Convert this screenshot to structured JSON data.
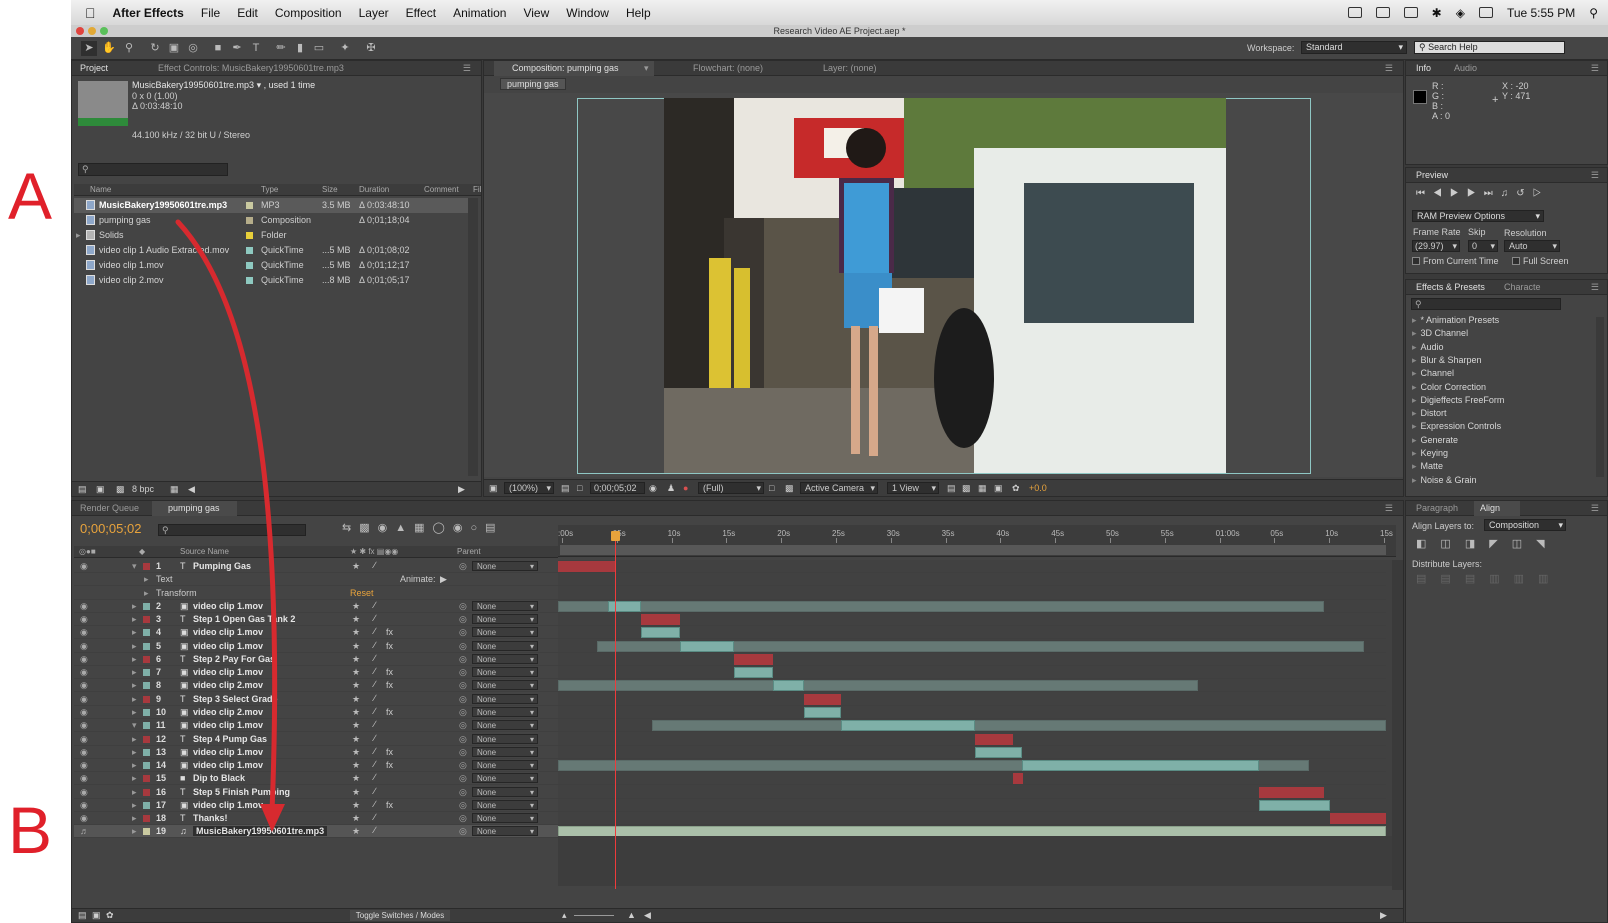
{
  "annotations": {
    "a": "A",
    "b": "B"
  },
  "colors": {
    "accent": "#e8a33c",
    "arrow": "#d72a2f",
    "layer_red": "#a7393e",
    "layer_teal": "#7fb0a8",
    "playhead": "#ee3b3b"
  },
  "menubar": {
    "apple": "apple-icon",
    "app": "After Effects",
    "items": [
      "File",
      "Edit",
      "Composition",
      "Layer",
      "Effect",
      "Animation",
      "View",
      "Window",
      "Help"
    ],
    "clock": "Tue 5:55 PM"
  },
  "window": {
    "title": "Research Video AE Project.aep *"
  },
  "toolbar": {
    "workspace_label": "Workspace:",
    "workspace_value": "Standard",
    "search_placeholder": "Search Help"
  },
  "project": {
    "tabs": [
      "Project",
      "Effect Controls: MusicBakery19950601tre.mp3"
    ],
    "selected_name": "MusicBakery19950601tre.mp3 ▾ , used 1 time",
    "info_lines": [
      "0 x 0 (1.00)",
      "Δ 0:03:48:10"
    ],
    "audio_info": "44.100 kHz / 32 bit U / Stereo",
    "columns": [
      "Name",
      "Type",
      "Size",
      "Duration",
      "Comment",
      "Fil"
    ],
    "items": [
      {
        "name": "MusicBakery19950601tre.mp3",
        "type": "MP3",
        "size": "3.5 MB",
        "duration": "Δ 0:03:48:10",
        "color": "#c9c9a0"
      },
      {
        "name": "pumping gas",
        "type": "Composition",
        "size": "",
        "duration": "Δ 0;01;18;04",
        "color": "#b5ad8a"
      },
      {
        "name": "Solids",
        "type": "Folder",
        "size": "",
        "duration": "",
        "color": "#e8cf3a"
      },
      {
        "name": "video clip 1 Audio Extracted.mov",
        "type": "QuickTime",
        "size": "...5 MB",
        "duration": "Δ 0;01;08;02",
        "color": "#8ec9c0"
      },
      {
        "name": "video clip 1.mov",
        "type": "QuickTime",
        "size": "...5 MB",
        "duration": "Δ 0;01;12;17",
        "color": "#8ec9c0"
      },
      {
        "name": "video clip 2.mov",
        "type": "QuickTime",
        "size": "...8 MB",
        "duration": "Δ 0;01;05;17",
        "color": "#8ec9c0"
      }
    ],
    "bpc": "8 bpc"
  },
  "composition": {
    "tabs": [
      "Composition: pumping gas",
      "Flowchart: (none)",
      "Layer: (none)"
    ],
    "breadcrumb": "pumping gas",
    "zoom": "(100%)",
    "timecode": "0;00;05;02",
    "resolution": "(Full)",
    "camera": "Active Camera",
    "view": "1 View",
    "exposure": "+0.0"
  },
  "info": {
    "tabs": [
      "Info",
      "Audio"
    ],
    "r": "R :",
    "g": "G :",
    "b": "B :",
    "a": "A : 0",
    "x": "X : -20",
    "y": "Y : 471"
  },
  "preview": {
    "tab": "Preview",
    "ram_options": "RAM Preview Options",
    "frame_rate_label": "Frame Rate",
    "skip_label": "Skip",
    "resolution_label": "Resolution",
    "frame_rate": "(29.97)",
    "skip": "0",
    "resolution": "Auto",
    "from_current": "From Current Time",
    "full_screen": "Full Screen"
  },
  "effects": {
    "tabs": [
      "Effects & Presets",
      "Characte"
    ],
    "items": [
      "* Animation Presets",
      "3D Channel",
      "Audio",
      "Blur & Sharpen",
      "Channel",
      "Color Correction",
      "Digieffects FreeForm",
      "Distort",
      "Expression Controls",
      "Generate",
      "Keying",
      "Matte",
      "Noise & Grain"
    ]
  },
  "align": {
    "tabs": [
      "Paragraph",
      "Align"
    ],
    "align_to_label": "Align Layers to:",
    "align_to_value": "Composition",
    "distribute_label": "Distribute Layers:"
  },
  "timeline": {
    "tabs": [
      "Render Queue",
      "pumping gas"
    ],
    "timecode": "0;00;05;02",
    "source_header": "Source Name",
    "parent_header": "Parent",
    "ruler": [
      ":00s",
      "05s",
      "10s",
      "15s",
      "20s",
      "25s",
      "30s",
      "35s",
      "40s",
      "45s",
      "50s",
      "55s",
      "01:00s",
      "05s",
      "10s",
      "15s"
    ],
    "toggle": "Toggle Switches / Modes",
    "animate": "Animate:",
    "reset": "Reset",
    "layers": [
      {
        "num": "1",
        "name": "Pumping Gas",
        "kind": "text",
        "color": "#a7393e",
        "parent": "None",
        "start": 0,
        "end": 0.07,
        "bar": "red",
        "expanded": true,
        "props": [
          "Text",
          "Transform"
        ]
      },
      {
        "num": "2",
        "name": "video clip 1.mov",
        "kind": "footage",
        "color": "#7fb0a8",
        "parent": "None",
        "start": 0,
        "end": 0.925,
        "trim_start": 0.06,
        "trim_end": 0.1,
        "bar": "teal"
      },
      {
        "num": "3",
        "name": "Step 1 Open Gas Tank 2",
        "kind": "text",
        "color": "#a7393e",
        "parent": "None",
        "start": 0.1,
        "end": 0.147,
        "bar": "red"
      },
      {
        "num": "4",
        "name": "video clip 1.mov",
        "kind": "footage",
        "color": "#7fb0a8",
        "parent": "None",
        "start": 0.1,
        "end": 0.147,
        "bar": "teal",
        "fx": true
      },
      {
        "num": "5",
        "name": "video clip 1.mov",
        "kind": "footage",
        "color": "#7fb0a8",
        "parent": "None",
        "start": 0.047,
        "end": 0.973,
        "trim_start": 0.147,
        "trim_end": 0.213,
        "bar": "teal",
        "fx": true
      },
      {
        "num": "6",
        "name": "Step 2 Pay For Gas",
        "kind": "text",
        "color": "#a7393e",
        "parent": "None",
        "start": 0.213,
        "end": 0.26,
        "bar": "red"
      },
      {
        "num": "7",
        "name": "video clip 1.mov",
        "kind": "footage",
        "color": "#7fb0a8",
        "parent": "None",
        "start": 0.213,
        "end": 0.26,
        "bar": "teal",
        "fx": true
      },
      {
        "num": "8",
        "name": "video clip 2.mov",
        "kind": "footage",
        "color": "#7fb0a8",
        "parent": "None",
        "start": -0.02,
        "end": 0.773,
        "trim_start": 0.26,
        "trim_end": 0.297,
        "bar": "teal",
        "fx": true
      },
      {
        "num": "9",
        "name": "Step 3 Select Grade",
        "kind": "text",
        "color": "#a7393e",
        "parent": "None",
        "start": 0.297,
        "end": 0.342,
        "bar": "red"
      },
      {
        "num": "10",
        "name": "video clip 2.mov",
        "kind": "footage",
        "color": "#7fb0a8",
        "parent": "None",
        "start": 0.297,
        "end": 0.342,
        "bar": "teal",
        "fx": true
      },
      {
        "num": "11",
        "name": "video clip 1.mov",
        "kind": "footage",
        "color": "#7fb0a8",
        "parent": "None",
        "start": 0.113,
        "end": 1.0,
        "trim_start": 0.342,
        "trim_end": 0.504,
        "bar": "teal",
        "expanded": true
      },
      {
        "num": "12",
        "name": "Step 4 Pump Gas",
        "kind": "text",
        "color": "#a7393e",
        "parent": "None",
        "start": 0.504,
        "end": 0.549,
        "bar": "red"
      },
      {
        "num": "13",
        "name": "video clip 1.mov",
        "kind": "footage",
        "color": "#7fb0a8",
        "parent": "None",
        "start": 0.504,
        "end": 0.56,
        "bar": "teal",
        "fx": true
      },
      {
        "num": "14",
        "name": "video clip 1.mov",
        "kind": "footage",
        "color": "#7fb0a8",
        "parent": "None",
        "start": -0.02,
        "end": 0.907,
        "trim_start": 0.56,
        "trim_end": 0.847,
        "bar": "teal",
        "fx": true
      },
      {
        "num": "15",
        "name": "Dip to Black",
        "kind": "solid",
        "color": "#a7393e",
        "parent": "None",
        "start": 0.549,
        "end": 0.562,
        "bar": "red"
      },
      {
        "num": "16",
        "name": "Step 5 Finish Pumping",
        "kind": "text",
        "color": "#a7393e",
        "parent": "None",
        "start": 0.847,
        "end": 0.925,
        "bar": "red"
      },
      {
        "num": "17",
        "name": "video clip 1.mov",
        "kind": "footage",
        "color": "#7fb0a8",
        "parent": "None",
        "start": 0.847,
        "end": 0.932,
        "bar": "teal",
        "fx": true
      },
      {
        "num": "18",
        "name": "Thanks!",
        "kind": "text",
        "color": "#a7393e",
        "parent": "None",
        "start": 0.932,
        "end": 1.0,
        "bar": "red"
      },
      {
        "num": "19",
        "name": "MusicBakery19950601tre.mp3",
        "kind": "audio",
        "color": "#c9c9a0",
        "parent": "None",
        "start": 0,
        "end": 1.0,
        "bar": "audio",
        "selected": true
      }
    ]
  }
}
